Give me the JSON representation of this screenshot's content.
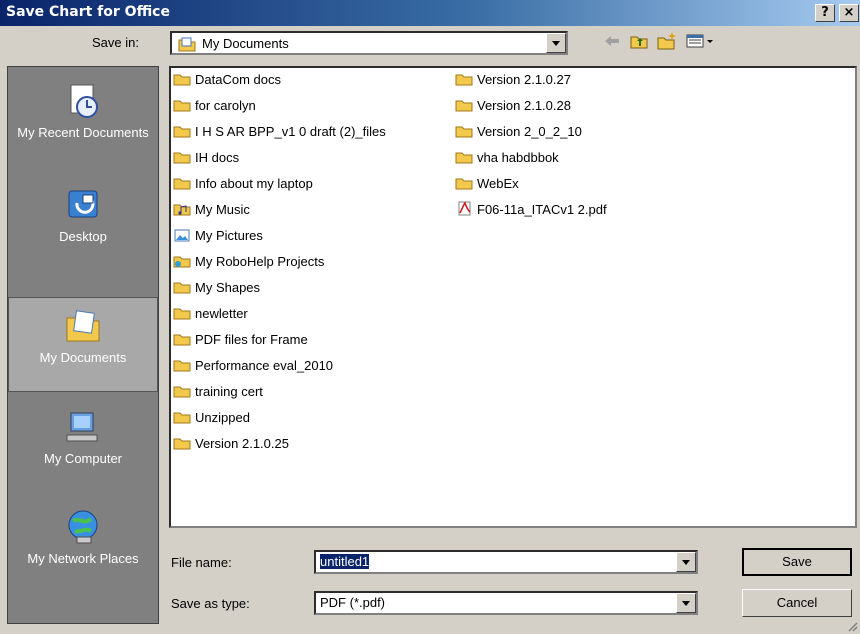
{
  "window": {
    "title": "Save Chart for Office",
    "help": "?",
    "close": "×"
  },
  "savein": {
    "label": "Save in:",
    "value": "My Documents"
  },
  "places": [
    {
      "label": "My Recent Documents",
      "icon": "recent-documents-icon"
    },
    {
      "label": "Desktop",
      "icon": "desktop-icon"
    },
    {
      "label": "My Documents",
      "icon": "my-documents-icon",
      "selected": true
    },
    {
      "label": "My Computer",
      "icon": "my-computer-icon"
    },
    {
      "label": "My Network Places",
      "icon": "network-places-icon"
    }
  ],
  "files": [
    {
      "name": "DataCom docs",
      "icon": "folder-icon"
    },
    {
      "name": "for carolyn",
      "icon": "folder-icon"
    },
    {
      "name": "I H S AR BPP_v1 0 draft (2)_files",
      "icon": "folder-icon"
    },
    {
      "name": "IH docs",
      "icon": "folder-icon"
    },
    {
      "name": "Info about my laptop",
      "icon": "folder-icon"
    },
    {
      "name": "My Music",
      "icon": "music-folder-icon"
    },
    {
      "name": "My Pictures",
      "icon": "pictures-folder-icon"
    },
    {
      "name": "My RoboHelp Projects",
      "icon": "robohelp-folder-icon"
    },
    {
      "name": "My Shapes",
      "icon": "folder-icon"
    },
    {
      "name": "newletter",
      "icon": "folder-icon"
    },
    {
      "name": "PDF files for Frame",
      "icon": "folder-icon"
    },
    {
      "name": "Performance eval_2010",
      "icon": "folder-icon"
    },
    {
      "name": "training cert",
      "icon": "folder-icon"
    },
    {
      "name": "Unzipped",
      "icon": "folder-icon"
    },
    {
      "name": "Version 2.1.0.25",
      "icon": "folder-icon"
    },
    {
      "name": "Version 2.1.0.27",
      "icon": "folder-icon"
    },
    {
      "name": "Version 2.1.0.28",
      "icon": "folder-icon"
    },
    {
      "name": "Version 2_0_2_10",
      "icon": "folder-icon"
    },
    {
      "name": "vha habdbbok",
      "icon": "folder-icon"
    },
    {
      "name": "WebEx",
      "icon": "folder-icon"
    },
    {
      "name": "F06-11a_ITACv1 2.pdf",
      "icon": "pdf-file-icon"
    }
  ],
  "filename": {
    "label": "File name:",
    "value": "untitled1"
  },
  "savetype": {
    "label": "Save as type:",
    "value": "PDF (*.pdf)"
  },
  "buttons": {
    "save": "Save",
    "cancel": "Cancel"
  },
  "colors": {
    "titlebar": "#0a246a",
    "selection": "#0a246a",
    "folder": "#f2c94c"
  }
}
